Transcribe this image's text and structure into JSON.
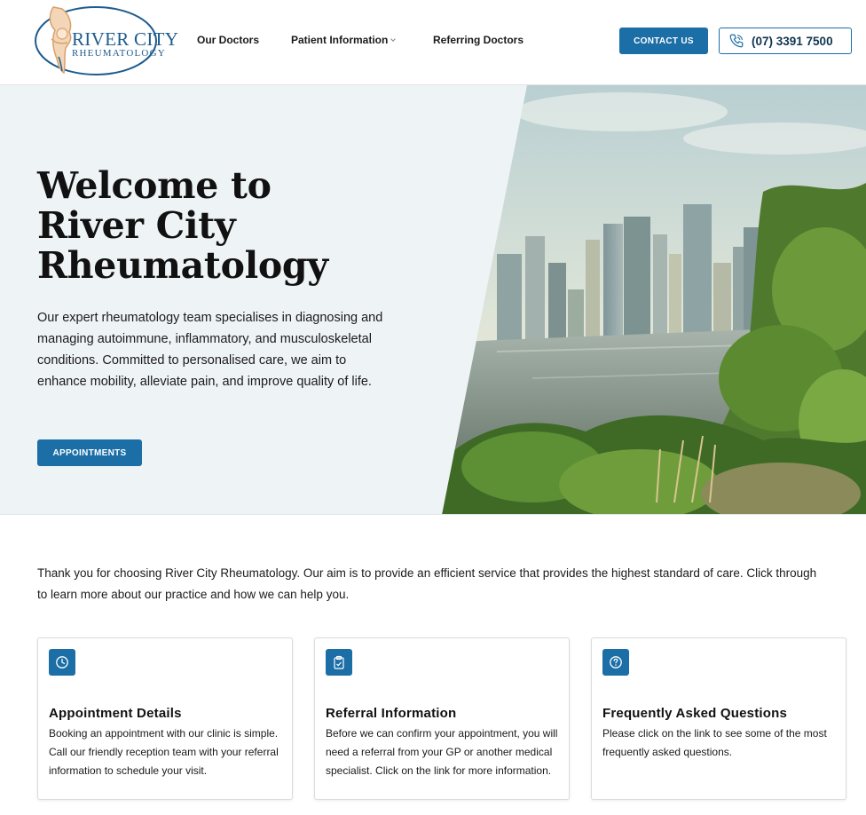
{
  "brand": {
    "name_line1": "RIVER CITY",
    "name_line2": "RHEUMATOLOGY",
    "logo_icon": "joint-logo-icon",
    "primary_color": "#1b6ea6",
    "accent_color": "#e8b07a"
  },
  "nav": {
    "items": [
      {
        "label": "Our Doctors"
      },
      {
        "label": "Patient Information",
        "dropdown_icon": "chevron-down-icon"
      },
      {
        "label": "Referring Doctors"
      }
    ]
  },
  "header": {
    "contact_label": "CONTACT US",
    "phone_label": "(07) 3391 7500",
    "phone_icon": "phone-icon"
  },
  "hero": {
    "title_lines": [
      "Welcome to",
      "River City",
      "Rheumatology"
    ],
    "body": "Our expert rheumatology team specialises in diagnosing and managing autoimmune, inflammatory, and musculoskeletal conditions. Committed to personalised care, we aim to enhance mobility, alleviate pain, and improve quality of life.",
    "cta_label": "APPOINTMENTS",
    "image": "city-skyline-river-photo"
  },
  "intro": {
    "text": "Thank you for choosing River City Rheumatology. Our aim is to provide an efficient service that provides the highest standard of care. Click through to learn more about our practice and how we can help you."
  },
  "cards": [
    {
      "icon": "clock-icon",
      "title": "Appointment Details",
      "text": "Booking an appointment with our clinic is simple. Call our friendly reception team with your referral information to schedule your visit."
    },
    {
      "icon": "clipboard-icon",
      "title": "Referral Information",
      "text": "Before we can confirm your appointment, you will need a referral from your GP or another medical specialist. Click on the link for more information."
    },
    {
      "icon": "question-circle-icon",
      "title": "Frequently Asked Questions",
      "text": "Please click on the link to see some of the most frequently asked questions."
    }
  ]
}
